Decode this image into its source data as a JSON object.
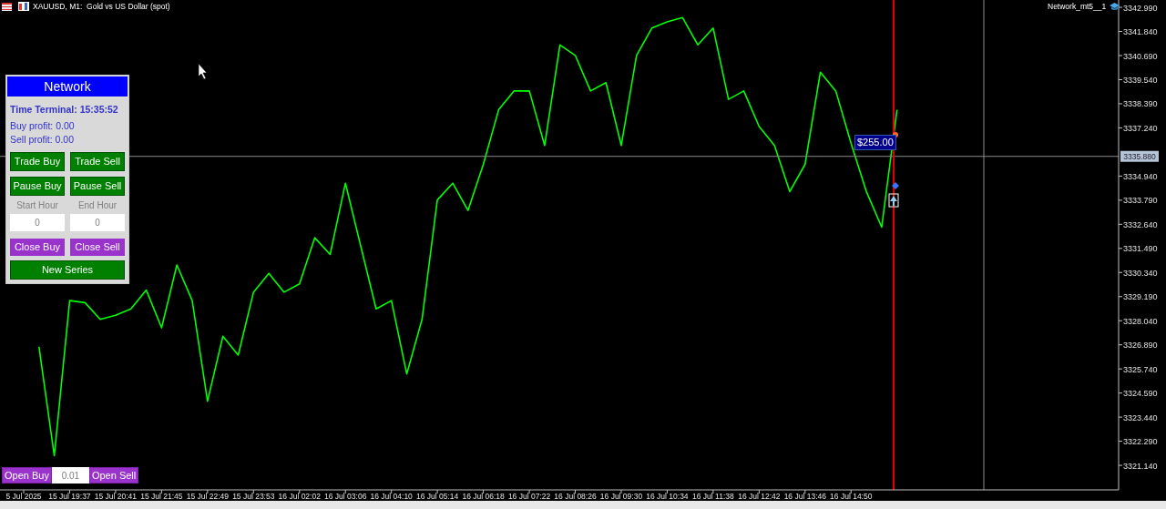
{
  "chart_title": "XAUUSD, M1:  Gold vs US Dollar (spot)",
  "expert_name": "Network_mt5__1",
  "panel": {
    "title": "Network",
    "time_terminal": "Time Terminal: 15:35:52",
    "buy_profit": "Buy profit: 0.00",
    "sell_profit": "Sell profit: 0.00",
    "buttons": [
      "Trade Buy",
      "Trade Sell",
      "Pause Buy",
      "Pause Sell"
    ],
    "hours": [
      {
        "label": "Start Hour",
        "value": "0"
      },
      {
        "label": "End Hour",
        "value": "0"
      }
    ],
    "close_buttons": [
      "Close Buy",
      "Close Sell"
    ],
    "new_series": "New Series"
  },
  "order_bar": {
    "buy_label": "Open Buy",
    "lot": "0.01",
    "sell_label": "Open Sell"
  },
  "profit_label": "$255.00",
  "chart_data": {
    "type": "line",
    "ylim": [
      3319.97,
      3343.34
    ],
    "ref_lines": [
      {
        "axis": "y",
        "value": 3335.88,
        "label": "3335.880"
      }
    ],
    "categories": [
      "5 Jul 2025",
      null,
      null,
      "15 Jul 19:37",
      null,
      null,
      "15 Jul 20:41",
      null,
      null,
      "15 Jul 21:45",
      null,
      null,
      "15 Jul 22:49",
      null,
      null,
      "15 Jul 23:53",
      null,
      null,
      "16 Jul 02:02",
      null,
      null,
      "16 Jul 03:06",
      null,
      null,
      "16 Jul 04:10",
      null,
      null,
      "16 Jul 05:14",
      null,
      null,
      "16 Jul 06:18",
      null,
      null,
      "16 Jul 07:22",
      null,
      null,
      "16 Jul 08:26",
      null,
      null,
      "16 Jul 09:30",
      null,
      null,
      "16 Jul 10:34",
      null,
      null,
      "16 Jul 11:38",
      null,
      null,
      "16 Jul 12:42",
      null,
      null,
      "16 Jul 13:46",
      null,
      null,
      "16 Jul 14:50",
      null,
      null,
      null
    ],
    "yticks": [
      {
        "value": 3342.99,
        "label": "3342.990"
      },
      {
        "value": 3341.84,
        "label": "3341.840"
      },
      {
        "value": 3340.69,
        "label": "3340.690"
      },
      {
        "value": 3339.54,
        "label": "3339.540"
      },
      {
        "value": 3338.39,
        "label": "3338.390"
      },
      {
        "value": 3337.24,
        "label": "3337.240"
      },
      {
        "value": 3334.94,
        "label": "3334.940"
      },
      {
        "value": 3333.79,
        "label": "3333.790"
      },
      {
        "value": 3332.64,
        "label": "3332.640"
      },
      {
        "value": 3331.49,
        "label": "3331.490"
      },
      {
        "value": 3330.34,
        "label": "3330.340"
      },
      {
        "value": 3329.19,
        "label": "3329.190"
      },
      {
        "value": 3328.04,
        "label": "3328.040"
      },
      {
        "value": 3326.89,
        "label": "3326.890"
      },
      {
        "value": 3325.74,
        "label": "3325.740"
      },
      {
        "value": 3324.59,
        "label": "3324.590"
      },
      {
        "value": 3323.44,
        "label": "3323.440"
      },
      {
        "value": 3322.29,
        "label": "3322.290"
      },
      {
        "value": 3321.14,
        "label": "3321.140"
      }
    ],
    "series": [
      {
        "color": "#00ff00",
        "values": [
          null,
          3326.8,
          3321.6,
          3329.0,
          3328.9,
          3328.1,
          3328.3,
          3328.6,
          3329.5,
          3327.7,
          3330.7,
          3329.0,
          3324.2,
          3327.3,
          3326.4,
          3329.4,
          3330.3,
          3329.4,
          3329.8,
          3332.0,
          3331.2,
          3334.6,
          3331.6,
          3328.6,
          3329.0,
          3325.5,
          3328.1,
          3333.8,
          3334.6,
          3333.3,
          3335.5,
          3338.1,
          3339.0,
          3339.0,
          3336.4,
          3341.2,
          3340.7,
          3339.0,
          3339.4,
          3336.4,
          3340.7,
          3342.0,
          3342.3,
          3342.5,
          3341.2,
          3342.0,
          3338.6,
          3339.0,
          3337.3,
          3336.4,
          3334.2,
          3335.5,
          3339.9,
          3339.0,
          3336.5,
          3334.2,
          3332.5,
          3338.1
        ]
      }
    ]
  }
}
